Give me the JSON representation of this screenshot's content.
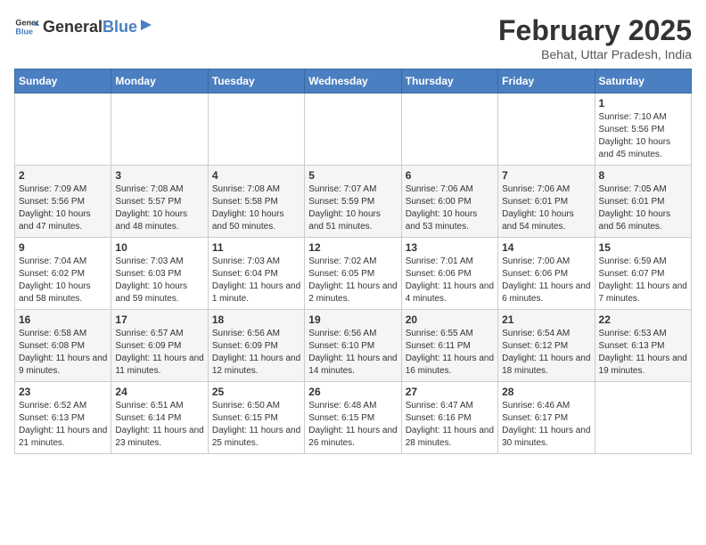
{
  "header": {
    "logo_general": "General",
    "logo_blue": "Blue",
    "month_title": "February 2025",
    "location": "Behat, Uttar Pradesh, India"
  },
  "days_of_week": [
    "Sunday",
    "Monday",
    "Tuesday",
    "Wednesday",
    "Thursday",
    "Friday",
    "Saturday"
  ],
  "weeks": [
    [
      {
        "day": "",
        "info": ""
      },
      {
        "day": "",
        "info": ""
      },
      {
        "day": "",
        "info": ""
      },
      {
        "day": "",
        "info": ""
      },
      {
        "day": "",
        "info": ""
      },
      {
        "day": "",
        "info": ""
      },
      {
        "day": "1",
        "info": "Sunrise: 7:10 AM\nSunset: 5:56 PM\nDaylight: 10 hours and 45 minutes."
      }
    ],
    [
      {
        "day": "2",
        "info": "Sunrise: 7:09 AM\nSunset: 5:56 PM\nDaylight: 10 hours and 47 minutes."
      },
      {
        "day": "3",
        "info": "Sunrise: 7:08 AM\nSunset: 5:57 PM\nDaylight: 10 hours and 48 minutes."
      },
      {
        "day": "4",
        "info": "Sunrise: 7:08 AM\nSunset: 5:58 PM\nDaylight: 10 hours and 50 minutes."
      },
      {
        "day": "5",
        "info": "Sunrise: 7:07 AM\nSunset: 5:59 PM\nDaylight: 10 hours and 51 minutes."
      },
      {
        "day": "6",
        "info": "Sunrise: 7:06 AM\nSunset: 6:00 PM\nDaylight: 10 hours and 53 minutes."
      },
      {
        "day": "7",
        "info": "Sunrise: 7:06 AM\nSunset: 6:01 PM\nDaylight: 10 hours and 54 minutes."
      },
      {
        "day": "8",
        "info": "Sunrise: 7:05 AM\nSunset: 6:01 PM\nDaylight: 10 hours and 56 minutes."
      }
    ],
    [
      {
        "day": "9",
        "info": "Sunrise: 7:04 AM\nSunset: 6:02 PM\nDaylight: 10 hours and 58 minutes."
      },
      {
        "day": "10",
        "info": "Sunrise: 7:03 AM\nSunset: 6:03 PM\nDaylight: 10 hours and 59 minutes."
      },
      {
        "day": "11",
        "info": "Sunrise: 7:03 AM\nSunset: 6:04 PM\nDaylight: 11 hours and 1 minute."
      },
      {
        "day": "12",
        "info": "Sunrise: 7:02 AM\nSunset: 6:05 PM\nDaylight: 11 hours and 2 minutes."
      },
      {
        "day": "13",
        "info": "Sunrise: 7:01 AM\nSunset: 6:06 PM\nDaylight: 11 hours and 4 minutes."
      },
      {
        "day": "14",
        "info": "Sunrise: 7:00 AM\nSunset: 6:06 PM\nDaylight: 11 hours and 6 minutes."
      },
      {
        "day": "15",
        "info": "Sunrise: 6:59 AM\nSunset: 6:07 PM\nDaylight: 11 hours and 7 minutes."
      }
    ],
    [
      {
        "day": "16",
        "info": "Sunrise: 6:58 AM\nSunset: 6:08 PM\nDaylight: 11 hours and 9 minutes."
      },
      {
        "day": "17",
        "info": "Sunrise: 6:57 AM\nSunset: 6:09 PM\nDaylight: 11 hours and 11 minutes."
      },
      {
        "day": "18",
        "info": "Sunrise: 6:56 AM\nSunset: 6:09 PM\nDaylight: 11 hours and 12 minutes."
      },
      {
        "day": "19",
        "info": "Sunrise: 6:56 AM\nSunset: 6:10 PM\nDaylight: 11 hours and 14 minutes."
      },
      {
        "day": "20",
        "info": "Sunrise: 6:55 AM\nSunset: 6:11 PM\nDaylight: 11 hours and 16 minutes."
      },
      {
        "day": "21",
        "info": "Sunrise: 6:54 AM\nSunset: 6:12 PM\nDaylight: 11 hours and 18 minutes."
      },
      {
        "day": "22",
        "info": "Sunrise: 6:53 AM\nSunset: 6:13 PM\nDaylight: 11 hours and 19 minutes."
      }
    ],
    [
      {
        "day": "23",
        "info": "Sunrise: 6:52 AM\nSunset: 6:13 PM\nDaylight: 11 hours and 21 minutes."
      },
      {
        "day": "24",
        "info": "Sunrise: 6:51 AM\nSunset: 6:14 PM\nDaylight: 11 hours and 23 minutes."
      },
      {
        "day": "25",
        "info": "Sunrise: 6:50 AM\nSunset: 6:15 PM\nDaylight: 11 hours and 25 minutes."
      },
      {
        "day": "26",
        "info": "Sunrise: 6:48 AM\nSunset: 6:15 PM\nDaylight: 11 hours and 26 minutes."
      },
      {
        "day": "27",
        "info": "Sunrise: 6:47 AM\nSunset: 6:16 PM\nDaylight: 11 hours and 28 minutes."
      },
      {
        "day": "28",
        "info": "Sunrise: 6:46 AM\nSunset: 6:17 PM\nDaylight: 11 hours and 30 minutes."
      },
      {
        "day": "",
        "info": ""
      }
    ]
  ]
}
